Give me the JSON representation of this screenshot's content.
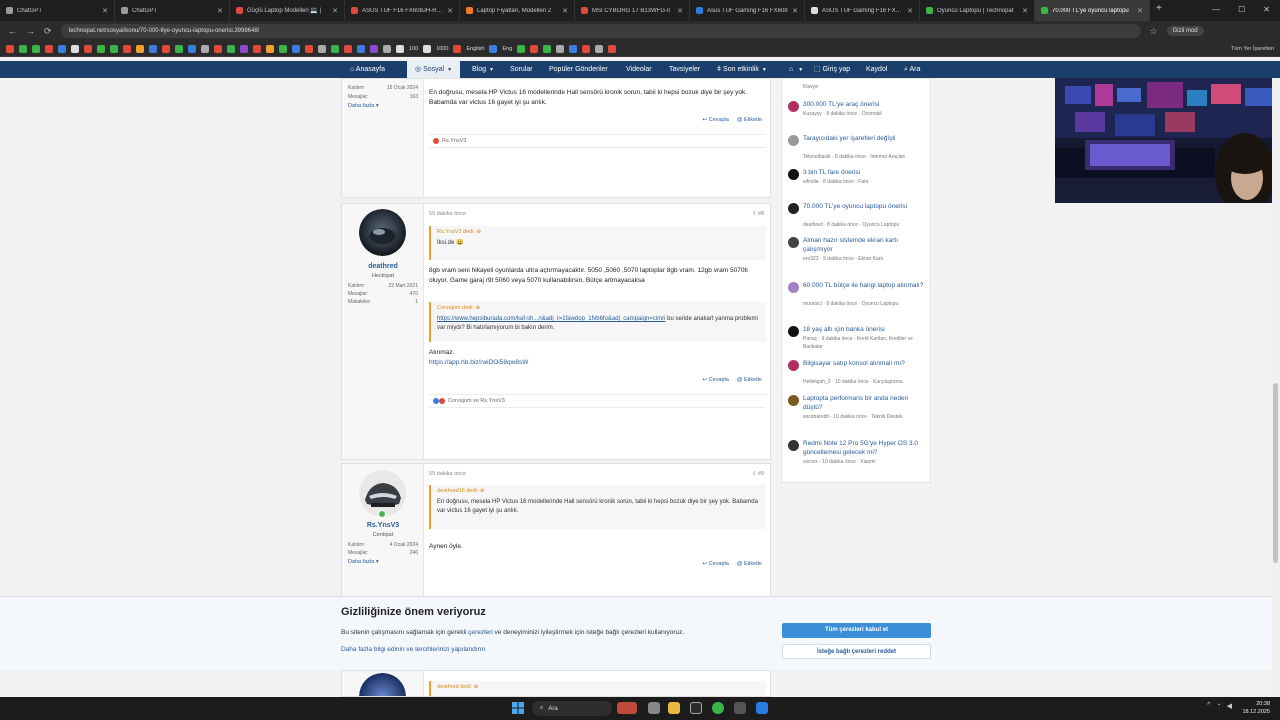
{
  "browser": {
    "tabs": [
      {
        "title": "ChatGPT",
        "color": "#9a9a9a"
      },
      {
        "title": "ChatGPT",
        "color": "#9a9a9a"
      },
      {
        "title": "Güçlü Laptop Modelleri 💻 |",
        "color": "#e0483b"
      },
      {
        "title": "ASUS TUF F16 FX608JH-RV0",
        "color": "#e0483b"
      },
      {
        "title": "Laptop Fiyatları, Modelleri 2",
        "color": "#f07c2a"
      },
      {
        "title": "MSI CYBORG 17 B13WFG-0",
        "color": "#e0483b"
      },
      {
        "title": "Asus TUF Gaming F16 FX608",
        "color": "#2a7de0"
      },
      {
        "title": "ASUS TUF Gaming F16 FX608",
        "color": "#dddddd"
      },
      {
        "title": "Oyuncu Laptopu | Technopat",
        "color": "#3bb54a"
      },
      {
        "title": "70.000 TL'ye oyuncu laptopu",
        "color": "#3bb54a",
        "active": true
      }
    ],
    "url": "technopat.net/sosyal/konu/70-000-tlye-oyuncu-laptopu-onerisi.3998648/",
    "incognito_label": "Gizli mod",
    "bookmarks": {
      "items": [
        "100",
        "1000",
        "English",
        "Eng"
      ],
      "all_label": "Tüm Yer İşaretleri"
    }
  },
  "site_nav": {
    "items": [
      "Anasayfa",
      "Sosyal",
      "Blog",
      "Sorular",
      "Popüler Gönderiler",
      "Videolar",
      "Tavsiyeler",
      "Son etkinlik"
    ],
    "login": "Giriş yap",
    "register": "Kaydol",
    "search": "Ara"
  },
  "posts": [
    {
      "stats": [
        {
          "k": "Katılım:",
          "v": "15 Ocak 2024"
        },
        {
          "k": "Mesajlar:",
          "v": "163"
        }
      ],
      "daha": "Daha fazla",
      "text": "En doğrusu, mesela HP Victus 16 modellerinde Hall sensörü kronik sorun, tabii ki hepsi bozuk diye bir şey yok. Babamda var victus 16 gayet iyi şu anlık.",
      "actions": [
        "Cevapla",
        "Etiketle"
      ],
      "reactions": "Rs.YnsV3"
    },
    {
      "time": "59 dakika önce",
      "num": "#8",
      "username": "deathred",
      "usertitle": "Hectopat",
      "stats": [
        {
          "k": "Katılım:",
          "v": "22 Mart 2021"
        },
        {
          "k": "Mesajlar:",
          "v": "470"
        },
        {
          "k": "Makaleler:",
          "v": "1"
        }
      ],
      "quote1_head": "Rs.YnsV3 dedi:",
      "quote1_text": "İksi.de 😀",
      "text": "8gb vram seni hikayeli oyunlarda ultra açtırmayacaktır. 5050 ,5060 ,5070 laptoplar 8gb vram. 12gb vram 5070ti oluyor. Game garaj r9t 5060 veya 5070 kullanabilirsin. Bütçe artmayacaksa",
      "quote2_head": "Corvajum dedi:",
      "quote2_link": "https://www.hepsiburada.com/kaf-sh...n&adj_t=1fawdop_1fvb6fo&adj_campaign=cimri",
      "quote2_text": " bu seride anakart yanma problemi var miydı? Bi hatırlamıyorum bi bakın derim.",
      "alinmaz": "Alınmaz.",
      "link": "https://app.hb.biz/rwiDOi58qw8sW",
      "actions": [
        "Cevapla",
        "Etiketle"
      ],
      "reactions": "Corvajum ve Rs.YnsV3"
    },
    {
      "time": "59 dakika önce",
      "num": "#9",
      "username": "Rs.YnsV3",
      "usertitle": "Centipat",
      "stats": [
        {
          "k": "Katılım:",
          "v": "4 Ocak 2024"
        },
        {
          "k": "Mesajlar:",
          "v": "246"
        }
      ],
      "daha": "Daha fazla",
      "quote_head": "deathred16 dedi:",
      "quote_text": "En doğrusu, mesela HP Victus 16 modellerinde Hall sensörü kronik sorun, tabii ki hepsi bozuk diye bir şey yok. Babamda var victus 16 gayet iyi şu anlık.",
      "text": "Aynen öyle.",
      "actions": [
        "Cevapla",
        "Etiketle"
      ]
    },
    {
      "quote_head": "deathred dedi:"
    }
  ],
  "sidebar": [
    {
      "title": "",
      "sub": "Klavye",
      "color": "#888888"
    },
    {
      "title": "300.000 TL'ye araç önerisi",
      "sub": "Kusayyy · 8 dakika önce · Otomobil",
      "color": "#b03060"
    },
    {
      "title": "Tarayıcıdaki yer işaretleri değişti",
      "sub": "Tekmelbasik · 8 dakika önce · İnternet Araçları",
      "color": "#999999"
    },
    {
      "title": "3 bin TL fare önerisi",
      "sub": "wfoolla · 8 dakika önce · Fare",
      "color": "#111111"
    },
    {
      "title": "70.000 TL'ye oyuncu laptopu önerisi",
      "sub": "deathred · 8 dakika önce · Oyuncu Laptopu",
      "color": "#222222"
    },
    {
      "title": "Alman hazır sistemde ekran kartı çalışmıyor",
      "sub": "ero323 · 9 dakika önce · Ekran Kartı",
      "color": "#444444"
    },
    {
      "title": "60.000 TL bütçe ile hangi laptop alınmalı?",
      "sub": "muratscl · 9 dakika önce · Oyuncu Laptopu",
      "color": "#a080c0"
    },
    {
      "title": "18 yaş altı için banka önerisi",
      "sub": "Panuç · 9 dakika önce · Kredi Kartları, Krediler ve Bankalar",
      "color": "#111111"
    },
    {
      "title": "Bilgisayar satıp konsol alınmalı mı?",
      "sub": "Hellelujah_0 · 10 dakika önce · Karşılaştırma",
      "color": "#b03060"
    },
    {
      "title": "Laptopta performans bir anda neden düştü?",
      "sub": "escobaredit · 10 dakika önce · Teknik Destek",
      "color": "#7a5a20"
    },
    {
      "title": "Redmi Note 12 Pro 5G'ye Hyper OS 3.0 güncellemesi gelecek mi?",
      "sub": "xoroxx · 10 dakika önce · Xiaomi",
      "color": "#333333"
    }
  ],
  "cookie": {
    "title": "Gizliliğinize önem veriyoruz",
    "text_before": "Bu sitenin çalışmasını sağlamak için gerekli ",
    "text_link": "çerezleri",
    "text_after": " ve deneyiminizi iyileştirmek için isteğe bağlı çerezleri kullanıyoruz.",
    "more_link": "Daha fazla bilgi edinin ve tercihlerinizi yapılandırın",
    "accept": "Tüm çerezleri kabul et",
    "reject": "İsteğe bağlı çerezleri reddet"
  },
  "taskbar": {
    "search": "Ara",
    "time": "20:38",
    "date": "18.12.2025"
  }
}
